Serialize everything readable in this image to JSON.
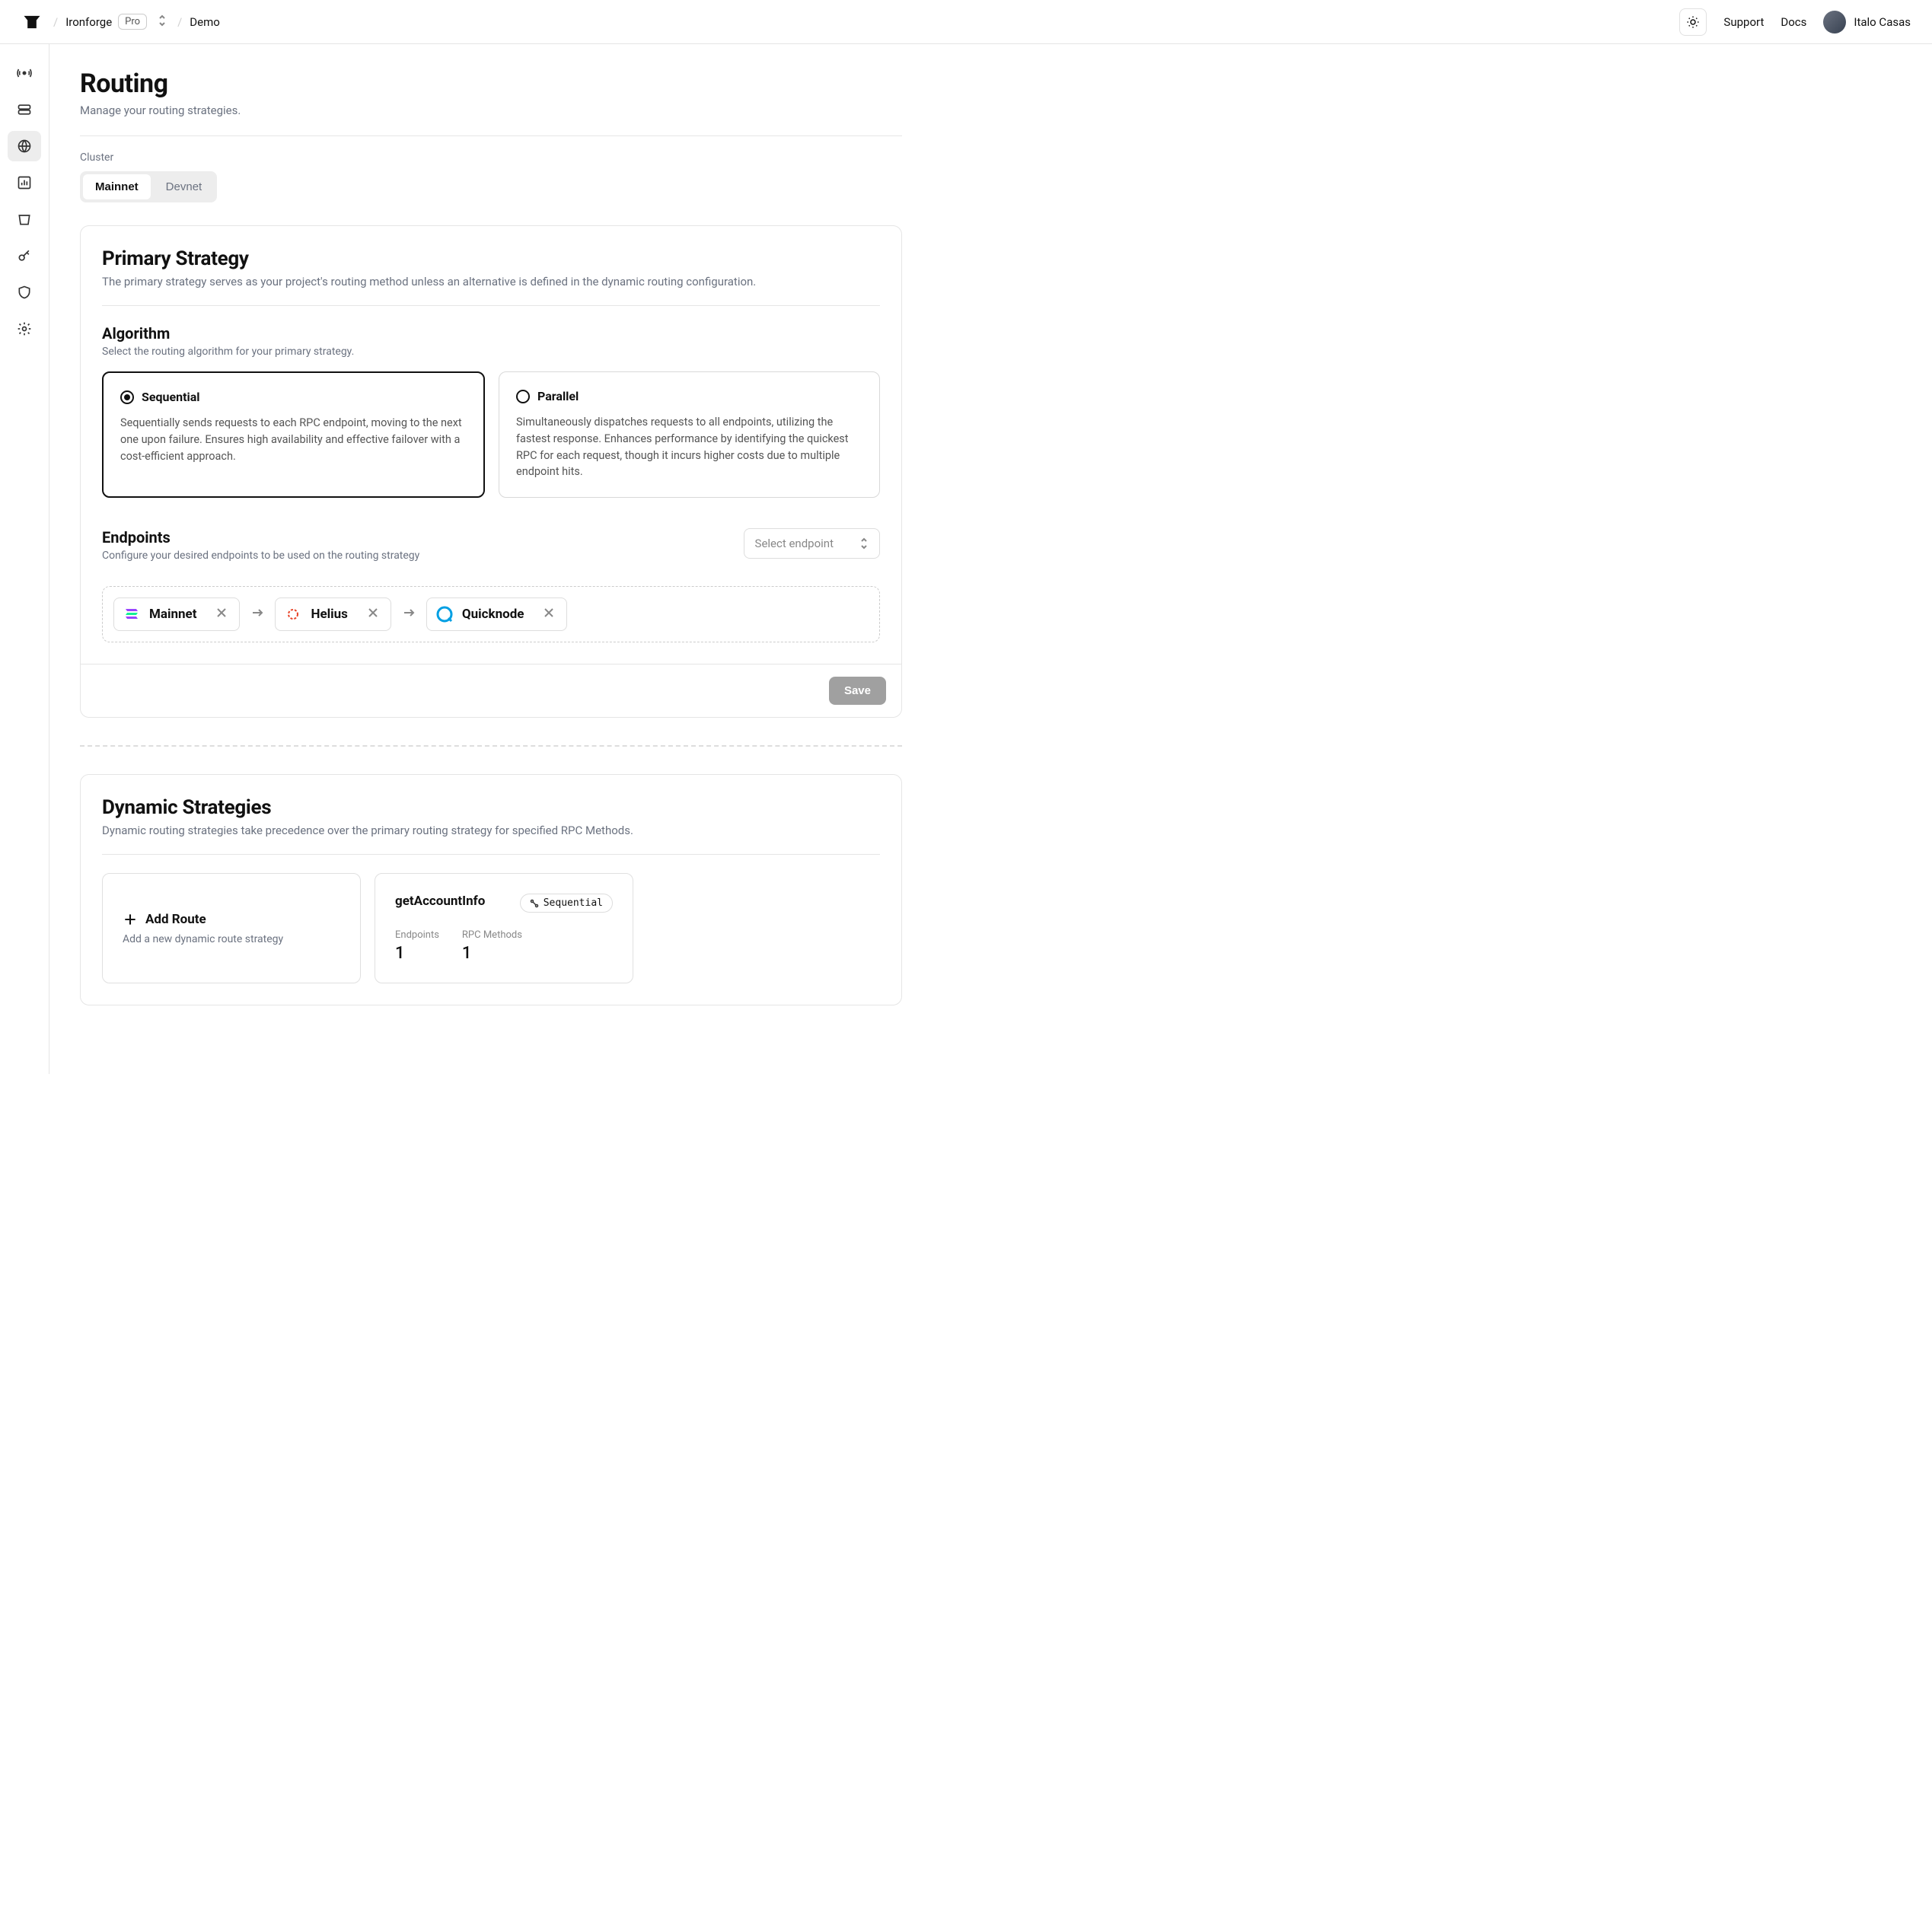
{
  "header": {
    "org": "Ironforge",
    "plan": "Pro",
    "project": "Demo",
    "support": "Support",
    "docs": "Docs",
    "user": "Italo Casas"
  },
  "page": {
    "title": "Routing",
    "subtitle": "Manage your routing strategies.",
    "cluster_label": "Cluster",
    "clusters": [
      "Mainnet",
      "Devnet"
    ],
    "cluster_active": "Mainnet"
  },
  "primary": {
    "title": "Primary Strategy",
    "subtitle": "The primary strategy serves as your project's routing method unless an alternative is defined in the dynamic routing configuration.",
    "algo_title": "Algorithm",
    "algo_subtitle": "Select the routing algorithm for your primary strategy.",
    "options": [
      {
        "name": "Sequential",
        "desc": "Sequentially sends requests to each RPC endpoint, moving to the next one upon failure. Ensures high availability and effective failover with a cost-efficient approach.",
        "selected": true
      },
      {
        "name": "Parallel",
        "desc": "Simultaneously dispatches requests to all endpoints, utilizing the fastest response. Enhances performance by identifying the quickest RPC for each request, though it incurs higher costs due to multiple endpoint hits.",
        "selected": false
      }
    ],
    "endpoints_title": "Endpoints",
    "endpoints_subtitle": "Configure your desired endpoints to be used on the routing strategy",
    "select_placeholder": "Select endpoint",
    "endpoints": [
      "Mainnet",
      "Helius",
      "Quicknode"
    ],
    "save": "Save"
  },
  "dynamic": {
    "title": "Dynamic Strategies",
    "subtitle": "Dynamic routing strategies take precedence over the primary routing strategy for specified RPC Methods.",
    "add_title": "Add Route",
    "add_subtitle": "Add a new dynamic route strategy",
    "route": {
      "name": "getAccountInfo",
      "badge": "Sequential",
      "stats": [
        {
          "label": "Endpoints",
          "value": "1"
        },
        {
          "label": "RPC Methods",
          "value": "1"
        }
      ]
    }
  }
}
